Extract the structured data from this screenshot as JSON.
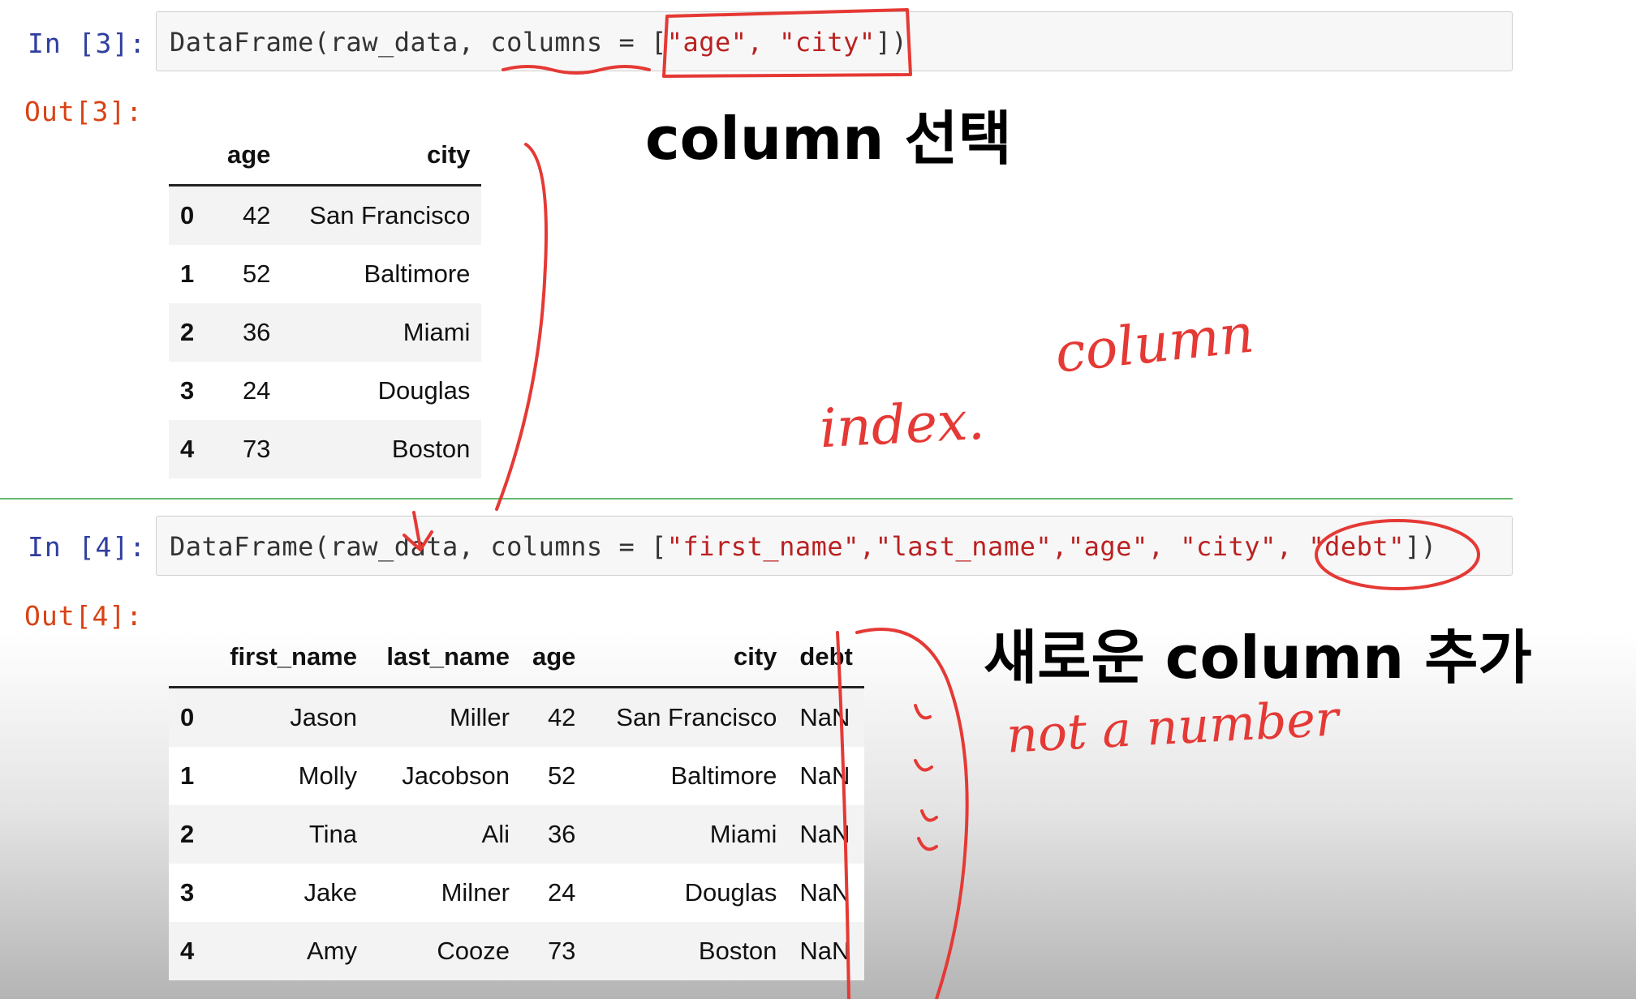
{
  "cell3": {
    "in_prompt": "In [3]:",
    "out_prompt": "Out[3]:",
    "code_pre": "DataFrame(raw_data, columns = [",
    "code_str": "\"age\", \"city\"",
    "code_post": "])",
    "table": {
      "columns": [
        "age",
        "city"
      ],
      "rows": [
        {
          "index": "0",
          "age": "42",
          "city": "San Francisco"
        },
        {
          "index": "1",
          "age": "52",
          "city": "Baltimore"
        },
        {
          "index": "2",
          "age": "36",
          "city": "Miami"
        },
        {
          "index": "3",
          "age": "24",
          "city": "Douglas"
        },
        {
          "index": "4",
          "age": "73",
          "city": "Boston"
        }
      ]
    }
  },
  "cell4": {
    "in_prompt": "In [4]:",
    "out_prompt": "Out[4]:",
    "code_pre": "DataFrame(raw_data, columns = [",
    "code_str": "\"first_name\",\"last_name\",\"age\", \"city\", \"debt\"",
    "code_post": "])",
    "table": {
      "columns": [
        "first_name",
        "last_name",
        "age",
        "city",
        "debt"
      ],
      "rows": [
        {
          "index": "0",
          "first_name": "Jason",
          "last_name": "Miller",
          "age": "42",
          "city": "San Francisco",
          "debt": "NaN"
        },
        {
          "index": "1",
          "first_name": "Molly",
          "last_name": "Jacobson",
          "age": "52",
          "city": "Baltimore",
          "debt": "NaN"
        },
        {
          "index": "2",
          "first_name": "Tina",
          "last_name": "Ali",
          "age": "36",
          "city": "Miami",
          "debt": "NaN"
        },
        {
          "index": "3",
          "first_name": "Jake",
          "last_name": "Milner",
          "age": "24",
          "city": "Douglas",
          "debt": "NaN"
        },
        {
          "index": "4",
          "first_name": "Amy",
          "last_name": "Cooze",
          "age": "73",
          "city": "Boston",
          "debt": "NaN"
        }
      ]
    }
  },
  "annotations": {
    "column_select": "column 선택",
    "column_hand": "column",
    "index_hand": "index.",
    "new_column": "새로운 column 추가",
    "not_a_number": "not a number"
  },
  "colors": {
    "ink": "#e53935",
    "in_prompt": "#303f9f",
    "out_prompt": "#d84315",
    "string": "#ba2121",
    "separator": "#66bb6a"
  }
}
